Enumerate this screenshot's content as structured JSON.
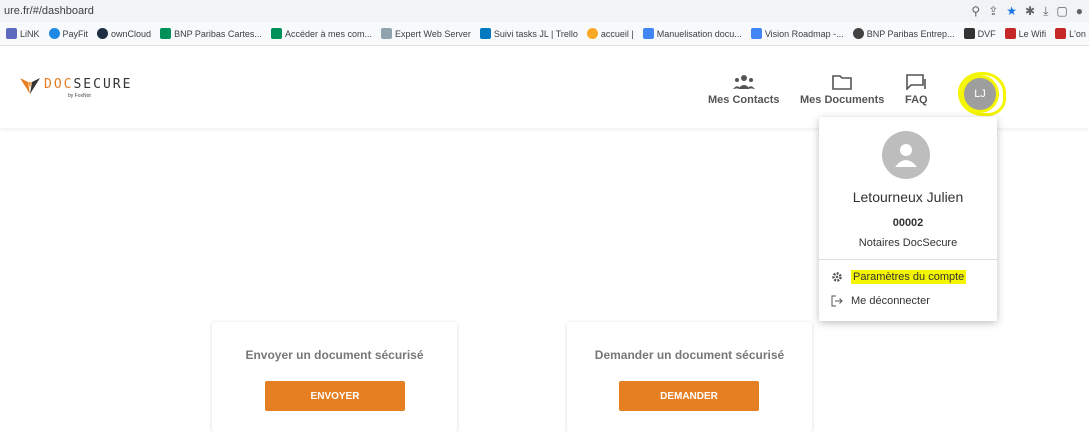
{
  "browser": {
    "url": "ure.fr/#/dashboard",
    "bookmarks": [
      {
        "label": "LiNK",
        "color": "#5c6bc0"
      },
      {
        "label": "PayFit",
        "color": "#1e88e5"
      },
      {
        "label": "ownCloud",
        "color": "#1d2d44"
      },
      {
        "label": "BNP Paribas Cartes...",
        "color": "#00915a"
      },
      {
        "label": "Accéder à mes com...",
        "color": "#00915a"
      },
      {
        "label": "Expert Web Server",
        "color": "#90a4ae"
      },
      {
        "label": "Suivi tasks JL | Trello",
        "color": "#0079bf"
      },
      {
        "label": "accueil |",
        "color": "#f9a825"
      },
      {
        "label": "Manuelisation docu...",
        "color": "#4285f4"
      },
      {
        "label": "Vision Roadmap -...",
        "color": "#4285f4"
      },
      {
        "label": "BNP Paribas Entrep...",
        "color": "#424242"
      },
      {
        "label": "DVF",
        "color": "#333333"
      },
      {
        "label": "Le Wifi",
        "color": "#c62828"
      },
      {
        "label": "L'on bo",
        "color": "#c62828"
      }
    ]
  },
  "header": {
    "logo_doc": "DOC",
    "logo_secure": "SECURE",
    "logo_sub": "by FoxNot",
    "nav": [
      {
        "label": "Mes Contacts"
      },
      {
        "label": "Mes Documents"
      },
      {
        "label": "FAQ"
      }
    ],
    "avatar_initials": "LJ"
  },
  "dropdown": {
    "name": "Letourneux Julien",
    "id": "00002",
    "organization": "Notaires DocSecure",
    "settings_label": "Paramètres du compte",
    "logout_label": "Me déconnecter"
  },
  "cards": [
    {
      "title": "Envoyer un document sécurisé",
      "button": "ENVOYER"
    },
    {
      "title": "Demander un document sécurisé",
      "button": "DEMANDER"
    }
  ],
  "colors": {
    "accent": "#e67e22",
    "highlight": "#f4f500"
  }
}
